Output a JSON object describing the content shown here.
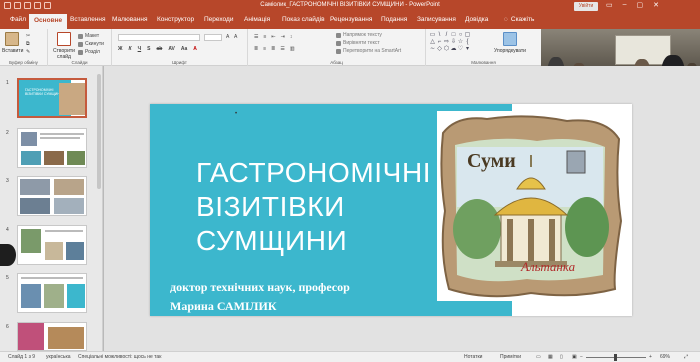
{
  "window": {
    "title": "Саміолик_ГАСТРОНОМІЧНІ ВІЗИТІВКИ СУМЩИНИ - PowerPoint",
    "signin": "Увійти"
  },
  "tabs": [
    {
      "label": "Файл"
    },
    {
      "label": "Основне"
    },
    {
      "label": "Вставлення"
    },
    {
      "label": "Малювання"
    },
    {
      "label": "Конструктор"
    },
    {
      "label": "Переходи"
    },
    {
      "label": "Анімація"
    },
    {
      "label": "Показ слайдів"
    },
    {
      "label": "Рецензування"
    },
    {
      "label": "Подання"
    },
    {
      "label": "Записування"
    },
    {
      "label": "Довідка"
    }
  ],
  "tellme": "Скажіть",
  "ribbon": {
    "clipboard": {
      "paste": "Вставити",
      "label": "Буфер обміну"
    },
    "slides": {
      "new_slide": "Створити слайд",
      "layout": "Макет",
      "reset": "Скинути",
      "section": "Розділ",
      "label": "Слайди"
    },
    "font": {
      "label": "Шрифт"
    },
    "paragraph": {
      "text_direction": "Напрямок тексту",
      "align_text": "Вирівняти текст",
      "smartart": "Перетворити на SmartArt",
      "label": "Абзац"
    },
    "drawing": {
      "arrange": "Упорядкувати",
      "quick_styles": "Швидкі стилі",
      "label": "Малювання"
    }
  },
  "slide": {
    "title_lines": [
      "ГАСТРОНОМІЧНІ",
      "ВІЗИТІВКИ",
      "СУМЩИНИ"
    ],
    "author_line1": "доктор технічних наук, професор",
    "author_line2": "Марина САМІЛИК",
    "souvenir_city": "Суми",
    "souvenir_script": "Альтанка"
  },
  "thumbnails": [
    {
      "num": "1"
    },
    {
      "num": "2"
    },
    {
      "num": "3"
    },
    {
      "num": "4"
    },
    {
      "num": "5"
    },
    {
      "num": "6"
    }
  ],
  "thumb1_title": "ГАСТРОНОМІЧНІ ВІЗИТІВКИ СУМЩИНИ",
  "status": {
    "slide_of": "Слайд 1 з 9",
    "language": "українська",
    "accessibility": "Спеціальні можливості: щось не так",
    "notes": "Нотатки",
    "comments": "Примітки",
    "zoom": "69%"
  },
  "colors": {
    "accent": "#b7472a",
    "slide_band": "#3cb7cd"
  }
}
